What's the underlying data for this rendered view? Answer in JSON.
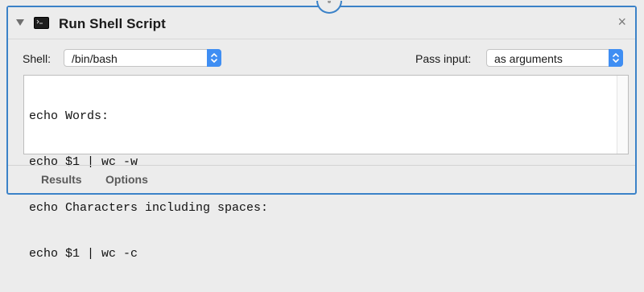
{
  "action": {
    "title": "Run Shell Script",
    "icon": "terminal-icon",
    "close_glyph": "×",
    "collapse_icon": "disclosure-triangle-icon"
  },
  "shell": {
    "label": "Shell:",
    "value": "/bin/bash"
  },
  "pass_input": {
    "label": "Pass input:",
    "value": "as arguments"
  },
  "script": {
    "lines": [
      "echo Words:",
      "echo $1 | wc -w",
      "echo Characters including spaces:",
      "echo $1 | wc -c"
    ]
  },
  "footer": {
    "tabs": [
      {
        "label": "Results"
      },
      {
        "label": "Options"
      }
    ]
  },
  "colors": {
    "accent": "#3b82c8",
    "stepper": "#3f8ef3",
    "background": "#ececec"
  }
}
